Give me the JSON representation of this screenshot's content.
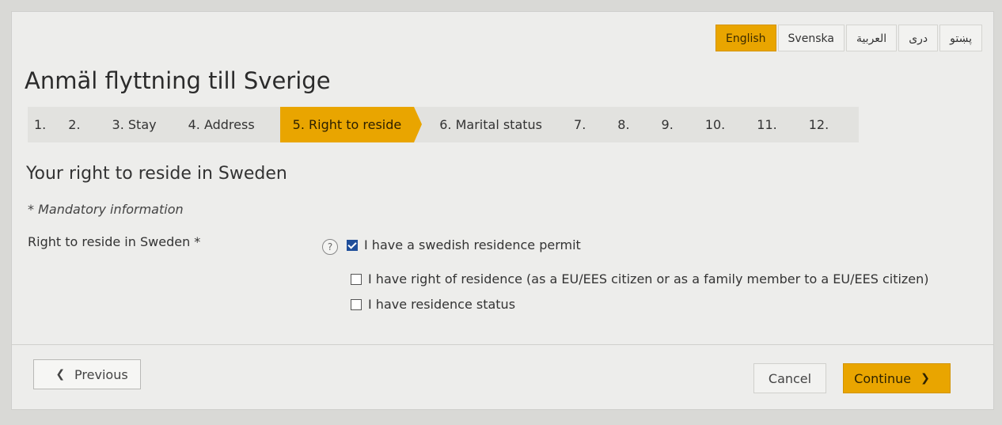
{
  "languages": [
    {
      "label": "English",
      "active": true
    },
    {
      "label": "Svenska",
      "active": false
    },
    {
      "label": "العربية",
      "active": false
    },
    {
      "label": "دری",
      "active": false
    },
    {
      "label": "پښتو",
      "active": false
    }
  ],
  "page_title": "Anmäl flyttning till Sverige",
  "steps": [
    "1.",
    "2.",
    "3. Stay",
    "4. Address",
    "5. Right to reside",
    "6. Marital status",
    "7.",
    "8.",
    "9.",
    "10.",
    "11.",
    "12."
  ],
  "active_step": 4,
  "section": {
    "title": "Your right to reside in Sweden",
    "mandatory_note": "* Mandatory information",
    "field_label": "Right to reside in Sweden *",
    "help_icon": "?",
    "options": [
      {
        "label": "I have a swedish residence permit",
        "checked": true
      },
      {
        "label": "I have right of residence (as a EU/EES citizen or as a family member to a EU/EES citizen)",
        "checked": false
      },
      {
        "label": "I have residence status",
        "checked": false
      }
    ]
  },
  "buttons": {
    "previous": "Previous",
    "cancel": "Cancel",
    "continue": "Continue"
  },
  "colors": {
    "accent": "#e9a500",
    "checkbox": "#1f4e9a"
  }
}
